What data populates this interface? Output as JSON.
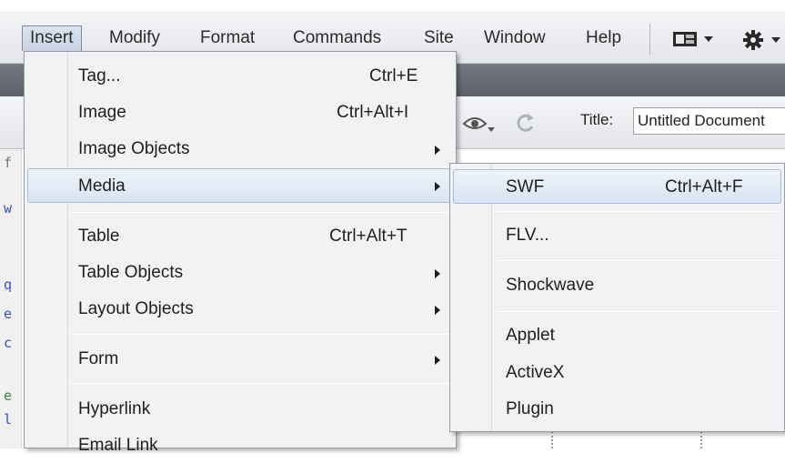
{
  "menubar": {
    "items": [
      "Insert",
      "Modify",
      "Format",
      "Commands",
      "Site",
      "Window",
      "Help"
    ],
    "active": "Insert",
    "layout_icon": "layout-grid-icon",
    "settings_icon": "gear-icon"
  },
  "document_toolbar": {
    "title_label": "Title:",
    "title_value": "Untitled Document",
    "preview_icon": "eye-preview-icon",
    "refresh_icon": "refresh-icon"
  },
  "insert_menu": {
    "items": [
      {
        "label": "Tag...",
        "shortcut": "Ctrl+E",
        "submenu": false
      },
      {
        "label": "Image",
        "shortcut": "Ctrl+Alt+I",
        "submenu": false
      },
      {
        "label": "Image Objects",
        "shortcut": "",
        "submenu": true
      },
      {
        "label": "Media",
        "shortcut": "",
        "submenu": true,
        "highlighted": true
      },
      {
        "label": "Table",
        "shortcut": "Ctrl+Alt+T",
        "submenu": false
      },
      {
        "label": "Table Objects",
        "shortcut": "",
        "submenu": true
      },
      {
        "label": "Layout Objects",
        "shortcut": "",
        "submenu": true
      },
      {
        "label": "Form",
        "shortcut": "",
        "submenu": true
      },
      {
        "label": "Hyperlink",
        "shortcut": "",
        "submenu": false
      },
      {
        "label": "Email Link",
        "shortcut": "",
        "submenu": false
      }
    ]
  },
  "media_submenu": {
    "items": [
      {
        "label": "SWF",
        "shortcut": "Ctrl+Alt+F",
        "highlighted": true
      },
      {
        "label": "FLV...",
        "shortcut": ""
      },
      {
        "label": "Shockwave",
        "shortcut": ""
      },
      {
        "label": "Applet",
        "shortcut": ""
      },
      {
        "label": "ActiveX",
        "shortcut": ""
      },
      {
        "label": "Plugin",
        "shortcut": ""
      }
    ]
  },
  "code_gutter": [
    "f",
    "w",
    "q",
    "e",
    "c",
    "e",
    "l"
  ],
  "colors": {
    "menu_bg": "#f1f2f4",
    "highlight": "#d8e4f3",
    "code_blue": "#3a4fc4",
    "code_green": "#2e8b3a"
  }
}
